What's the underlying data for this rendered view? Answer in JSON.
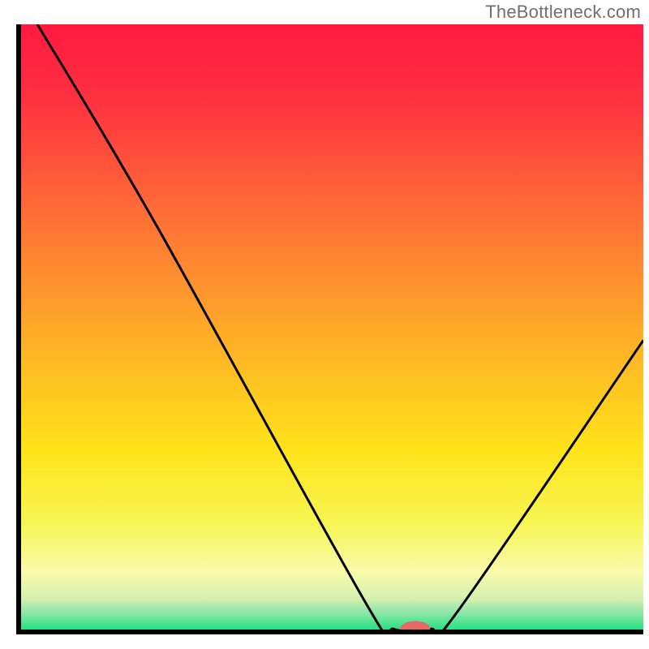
{
  "attribution": "TheBottleneck.com",
  "colors": {
    "frame": "#000000",
    "curve": "#000000",
    "marker_fill": "#e46868",
    "gradient_stops": [
      {
        "offset": 0.0,
        "color": "#ff1a3e"
      },
      {
        "offset": 0.12,
        "color": "#ff3040"
      },
      {
        "offset": 0.25,
        "color": "#ff5a3a"
      },
      {
        "offset": 0.4,
        "color": "#ff8a30"
      },
      {
        "offset": 0.55,
        "color": "#ffb824"
      },
      {
        "offset": 0.7,
        "color": "#ffe31a"
      },
      {
        "offset": 0.82,
        "color": "#f7f552"
      },
      {
        "offset": 0.9,
        "color": "#f9faa9"
      },
      {
        "offset": 0.945,
        "color": "#d6f0b0"
      },
      {
        "offset": 0.968,
        "color": "#8ee6a8"
      },
      {
        "offset": 1.0,
        "color": "#19e07e"
      }
    ]
  },
  "chart_data": {
    "type": "line",
    "title": "",
    "xlabel": "",
    "ylabel": "",
    "xlim": [
      0,
      100
    ],
    "ylim": [
      0,
      100
    ],
    "curve": [
      {
        "x": 3,
        "y": 100
      },
      {
        "x": 22,
        "y": 67
      },
      {
        "x": 56,
        "y": 4
      },
      {
        "x": 60,
        "y": 0.5
      },
      {
        "x": 66,
        "y": 0.5
      },
      {
        "x": 70,
        "y": 3
      },
      {
        "x": 100,
        "y": 48
      }
    ],
    "marker": {
      "x": 63.5,
      "y": 0.5,
      "rx": 2.4,
      "ry": 1.3
    },
    "annotations": []
  }
}
